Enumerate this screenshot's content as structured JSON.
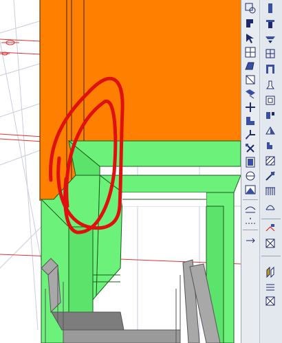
{
  "app": {
    "name": ""
  },
  "viewport": {
    "description_hidden": "",
    "colors": {
      "wall": "#ff8000",
      "frame": "#6cf27a",
      "frame_dark": "#36b647",
      "railing": "#9a9a9a",
      "annotation": "#e01010",
      "grid": "#c8cbe0"
    }
  },
  "toolbar_left": {
    "buttons": [
      {
        "name": "zoom-window-icon"
      },
      {
        "name": "pan-icon"
      },
      {
        "name": "select-object-icon"
      },
      {
        "name": "snap-icon"
      },
      {
        "name": "wall-tool-icon"
      },
      {
        "name": "window-tool-icon"
      },
      {
        "name": "door-tool-icon"
      },
      {
        "name": "stair-tool-icon"
      },
      {
        "name": "move-icon"
      },
      {
        "name": "copy-icon"
      },
      {
        "name": "mirror-icon"
      },
      {
        "name": "rotate-icon"
      },
      {
        "name": "trim-icon"
      },
      {
        "name": "extend-icon"
      },
      {
        "name": "railing-tool-icon"
      },
      {
        "name": "beam-tool-icon"
      },
      {
        "name": "dimension-icon"
      }
    ]
  },
  "toolbar_right": {
    "buttons": [
      {
        "name": "column-tool-icon"
      },
      {
        "name": "slab-tool-icon"
      },
      {
        "name": "roof-tool-icon"
      },
      {
        "name": "grid-tool-icon"
      },
      {
        "name": "ceiling-tool-icon"
      },
      {
        "name": "opening-tool-icon"
      },
      {
        "name": "profile-icon"
      },
      {
        "name": "section-icon"
      },
      {
        "name": "elevation-icon"
      },
      {
        "name": "text-tool-icon"
      },
      {
        "name": "hatch-icon"
      },
      {
        "name": "line-tool-icon"
      },
      {
        "name": "polyline-icon"
      },
      {
        "name": "measure-icon"
      },
      {
        "name": "layer-icon"
      },
      {
        "name": "properties-icon"
      }
    ]
  }
}
